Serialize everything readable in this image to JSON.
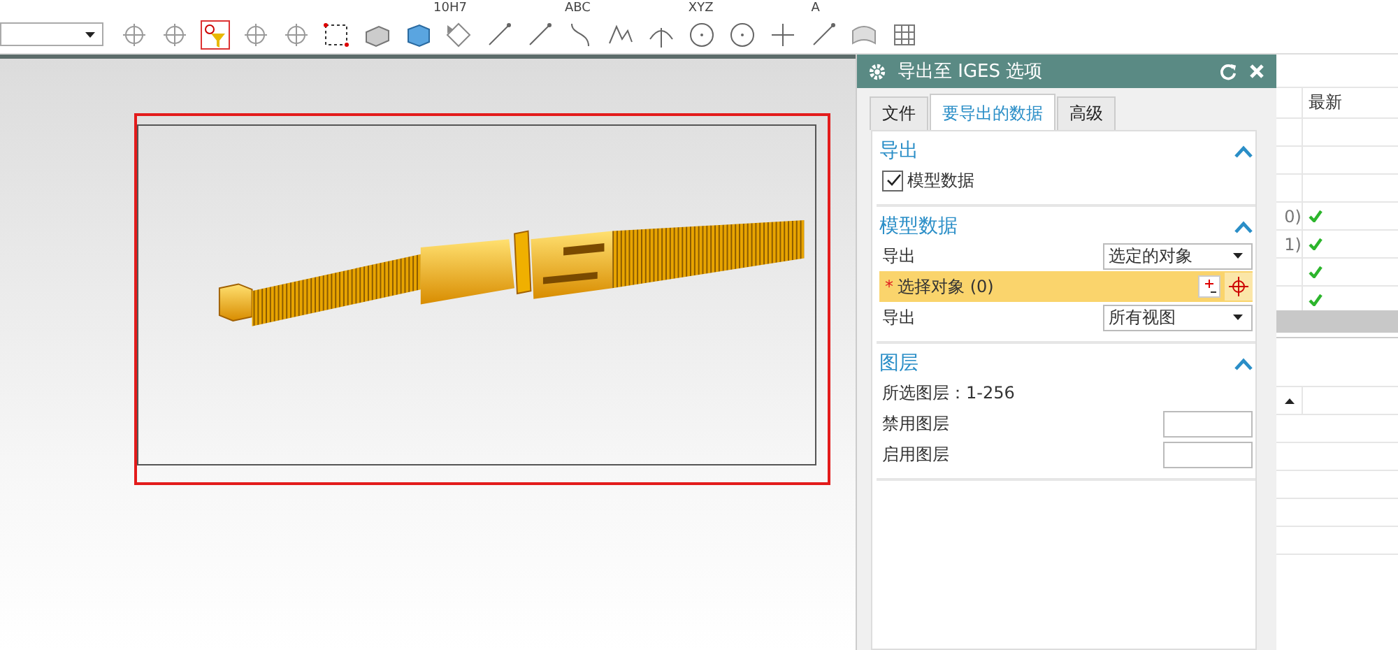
{
  "toolbar_top": {
    "labels": [
      "10H7",
      "ABC",
      "XYZ",
      "A"
    ]
  },
  "dialog": {
    "title": "导出至 IGES 选项",
    "tabs": [
      {
        "label": "文件",
        "selected": false
      },
      {
        "label": "要导出的数据",
        "selected": true
      },
      {
        "label": "高级",
        "selected": false
      }
    ],
    "sections": [
      {
        "title": "导出",
        "expanded": true,
        "items": [
          {
            "kind": "checkbox",
            "label": "模型数据",
            "checked": true
          }
        ]
      },
      {
        "title": "模型数据",
        "expanded": true,
        "items": [
          {
            "kind": "dropdown",
            "label": "导出",
            "value": "选定的对象"
          },
          {
            "kind": "selection",
            "label": "选择对象 (0)",
            "required_mark": "*",
            "selected": true
          },
          {
            "kind": "dropdown",
            "label": "导出",
            "value": "所有视图"
          }
        ]
      },
      {
        "title": "图层",
        "expanded": true,
        "items": [
          {
            "kind": "text",
            "label": "所选图层：1-256"
          },
          {
            "kind": "field",
            "label": "禁用图层"
          },
          {
            "kind": "field",
            "label": "启用图层"
          }
        ]
      }
    ]
  },
  "right_table": {
    "columns": [
      {
        "label": "最新"
      }
    ],
    "rows": [
      {
        "column_1": "",
        "latest": false
      },
      {
        "column_1": "",
        "latest": false
      },
      {
        "column_1": "",
        "latest": false
      },
      {
        "column_1": "0)",
        "latest": true
      },
      {
        "column_1": "1)",
        "latest": true
      },
      {
        "column_1": "",
        "latest": true
      },
      {
        "column_1": "",
        "latest": true
      }
    ]
  }
}
